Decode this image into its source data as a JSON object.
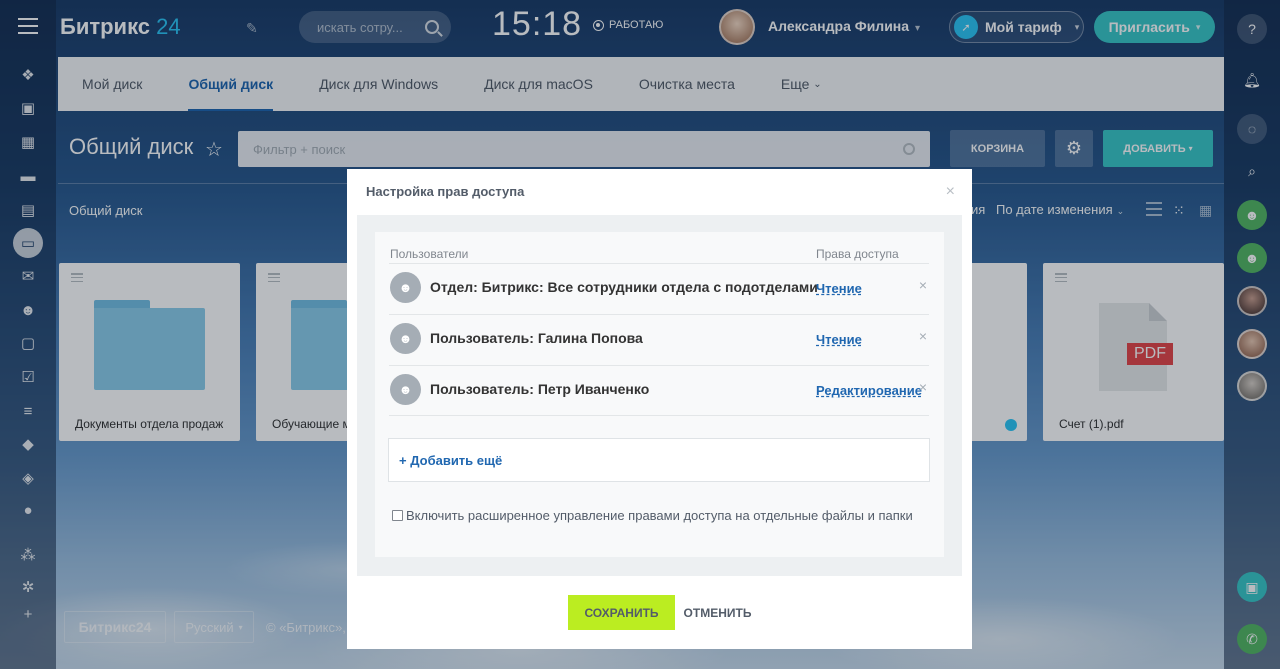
{
  "header": {
    "logo_text": "Битрикс",
    "logo_num": "24",
    "search_placeholder": "искать сотру...",
    "clock": "15:18",
    "work_status": "РАБОТАЮ",
    "user_name": "Александра Филина",
    "tariff_label": "Мой тариф",
    "invite_label": "Пригласить"
  },
  "tabs": [
    {
      "label": "Мой диск"
    },
    {
      "label": "Общий диск"
    },
    {
      "label": "Диск для Windows"
    },
    {
      "label": "Диск для macOS"
    },
    {
      "label": "Очистка места"
    },
    {
      "label": "Еще"
    }
  ],
  "page": {
    "title": "Общий диск",
    "filter_placeholder": "Фильтр + поиск",
    "trash_label": "КОРЗИНА",
    "add_label": "ДОБАВИТЬ",
    "breadcrumb": "Общий диск",
    "sort_label": "По дате изменения",
    "sort_partial": "ия"
  },
  "files": [
    {
      "name": "Документы отдела продаж"
    },
    {
      "name": "Обучающие м"
    },
    {
      "name": "Счет (1).pdf"
    }
  ],
  "footer": {
    "logo": "Битрикс24",
    "lang": "Русский",
    "copy": "© «Битрикс»,"
  },
  "modal": {
    "title": "Настройка прав доступа",
    "col_users": "Пользователи",
    "col_rights": "Права доступа",
    "rows": [
      {
        "label": "Отдел: Битрикс: Все сотрудники отдела с подотделами",
        "right": "Чтение"
      },
      {
        "label": "Пользователь: Галина Попова",
        "right": "Чтение"
      },
      {
        "label": "Пользователь: Петр Иванченко",
        "right": "Редактирование"
      }
    ],
    "add_more": "+ Добавить ещё",
    "checkbox_label": "Включить расширенное управление правами доступа на отдельные файлы и папки",
    "save_label": "СОХРАНИТЬ",
    "cancel_label": "ОТМЕНИТЬ"
  }
}
